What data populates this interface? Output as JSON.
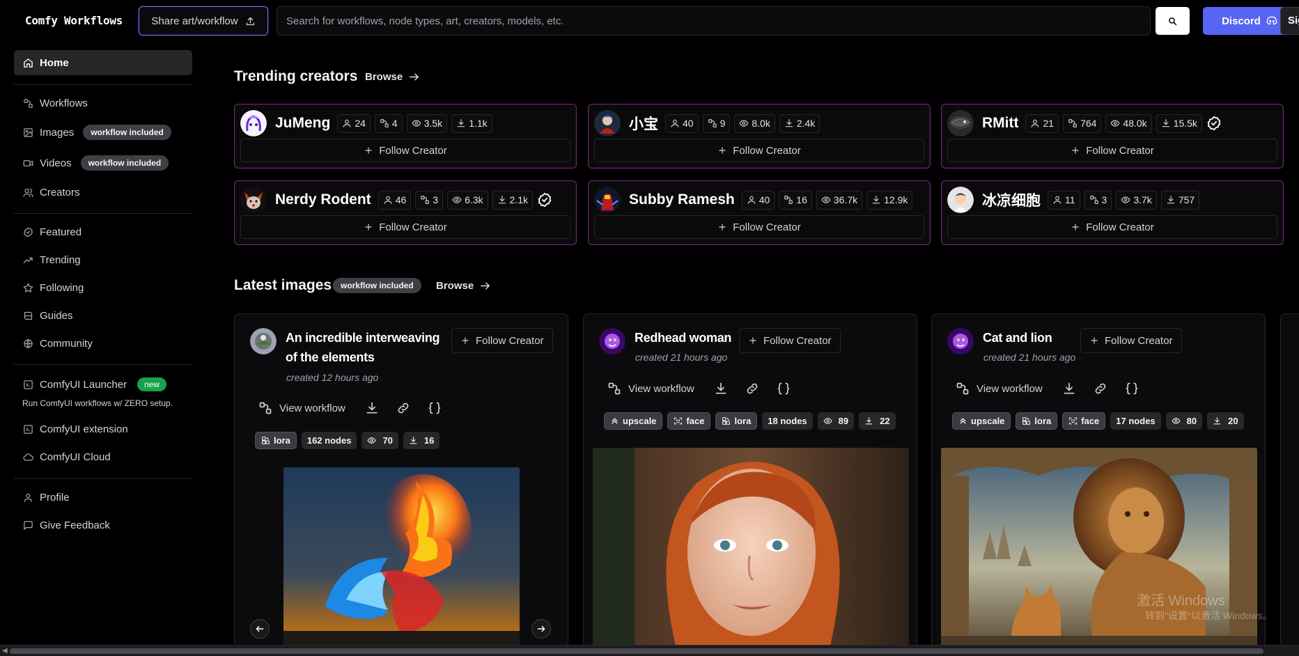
{
  "app": {
    "title": "Comfy Workflows"
  },
  "topbar": {
    "share_label": "Share art/workflow",
    "search_placeholder": "Search for workflows, node types, art, creators, models, etc.",
    "discord_label": "Discord",
    "sign_label": "Sign"
  },
  "sidebar": {
    "home": "Home",
    "workflows": "Workflows",
    "images": "Images",
    "images_pill": "workflow included",
    "videos": "Videos",
    "videos_pill": "workflow included",
    "creators": "Creators",
    "featured": "Featured",
    "trending": "Trending",
    "following": "Following",
    "guides": "Guides",
    "community": "Community",
    "launcher": "ComfyUI Launcher",
    "launcher_badge": "new",
    "launcher_note": "Run ComfyUI workflows w/ ZERO setup.",
    "extension": "ComfyUI extension",
    "cloud": "ComfyUI Cloud",
    "profile": "Profile",
    "feedback": "Give Feedback"
  },
  "trending": {
    "title": "Trending creators",
    "browse": "Browse",
    "follow_label": "Follow Creator",
    "creators": [
      {
        "name": "JuMeng",
        "followers": "24",
        "workflows": "4",
        "views": "3.5k",
        "downloads": "1.1k",
        "verified": false
      },
      {
        "name": "小宝",
        "followers": "40",
        "workflows": "9",
        "views": "8.0k",
        "downloads": "2.4k",
        "verified": false
      },
      {
        "name": "RMitt",
        "followers": "21",
        "workflows": "764",
        "views": "48.0k",
        "downloads": "15.5k",
        "verified": true
      },
      {
        "name": "Nerdy Rodent",
        "followers": "46",
        "workflows": "3",
        "views": "6.3k",
        "downloads": "2.1k",
        "verified": true
      },
      {
        "name": "Subby Ramesh",
        "followers": "40",
        "workflows": "16",
        "views": "36.7k",
        "downloads": "12.9k",
        "verified": false
      },
      {
        "name": "冰凉细胞",
        "followers": "11",
        "workflows": "3",
        "views": "3.7k",
        "downloads": "757",
        "verified": false
      }
    ]
  },
  "latest": {
    "title": "Latest images",
    "pill": "workflow included",
    "browse": "Browse",
    "view_workflow": "View workflow",
    "follow_label": "Follow Creator",
    "cards": [
      {
        "title_l1": "An incredible interweaving",
        "title_l2": "of the elements",
        "date": "created 12 hours ago",
        "tags": [
          "lora"
        ],
        "nodes": "162 nodes",
        "views": "70",
        "downloads": "16"
      },
      {
        "title": "Redhead woman",
        "date": "created 21 hours ago",
        "tags": [
          "upscale",
          "face",
          "lora"
        ],
        "nodes": "18 nodes",
        "views": "89",
        "downloads": "22"
      },
      {
        "title": "Cat and lion",
        "date": "created 21 hours ago",
        "tags": [
          "upscale",
          "lora",
          "face"
        ],
        "nodes": "17 nodes",
        "views": "80",
        "downloads": "20"
      }
    ]
  },
  "watermark": {
    "line1": "激活 Windows",
    "line2": "转到\"设置\"以激活 Windows。"
  },
  "colors": {
    "accent_purple": "#8b5cf6",
    "discord": "#5865f2",
    "new_badge": "#16a34a",
    "card_border": "#6b2a6b"
  }
}
